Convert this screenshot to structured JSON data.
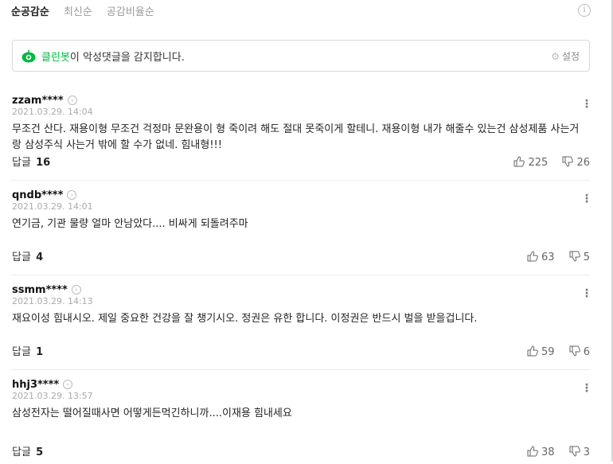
{
  "sort": {
    "tabs": [
      {
        "label": "순공감순",
        "active": true
      },
      {
        "label": "최신순",
        "active": false
      },
      {
        "label": "공감비율순",
        "active": false
      }
    ]
  },
  "cleanbot": {
    "brand": "클린봇",
    "message": "이 악성댓글을 감지합니다.",
    "settings_label": "설정",
    "brand_color": "#00b843"
  },
  "comments": [
    {
      "user": "zzam****",
      "date": "2021.03.29. 14:04",
      "text": "무조건 산다. 재용이형 무조건 걱정마 문완용이 형 죽이려 해도 절대 못죽이게 할테니. 재용이형 내가 해줄수 있는건 삼성제품 사는거랑 삼성주식 사는거 밖에 할 수가 없네. 힘내형!!!",
      "reply_label": "답글",
      "reply_count": "16",
      "likes": "225",
      "dislikes": "26"
    },
    {
      "user": "qndb****",
      "date": "2021.03.29. 14:01",
      "text": "연기금, 기관 물량 얼마 안남았다.... 비싸게 되돌려주마",
      "reply_label": "답글",
      "reply_count": "4",
      "likes": "63",
      "dislikes": "5"
    },
    {
      "user": "ssmm****",
      "date": "2021.03.29. 14:13",
      "text": "재요이성 힘내시오. 제일 중요한 건강을 잘 챙기시오. 정권은 유한 합니다. 이정권은 반드시 벌을 받을겁니다.",
      "reply_label": "답글",
      "reply_count": "1",
      "likes": "59",
      "dislikes": "6"
    },
    {
      "user": "hhj3****",
      "date": "2021.03.29. 13:57",
      "text": "삼성전자는 떨어질때사면 어떻게든먹긴하니까....이재용 힘내세요",
      "reply_label": "답글",
      "reply_count": "5",
      "likes": "38",
      "dislikes": "3"
    }
  ]
}
